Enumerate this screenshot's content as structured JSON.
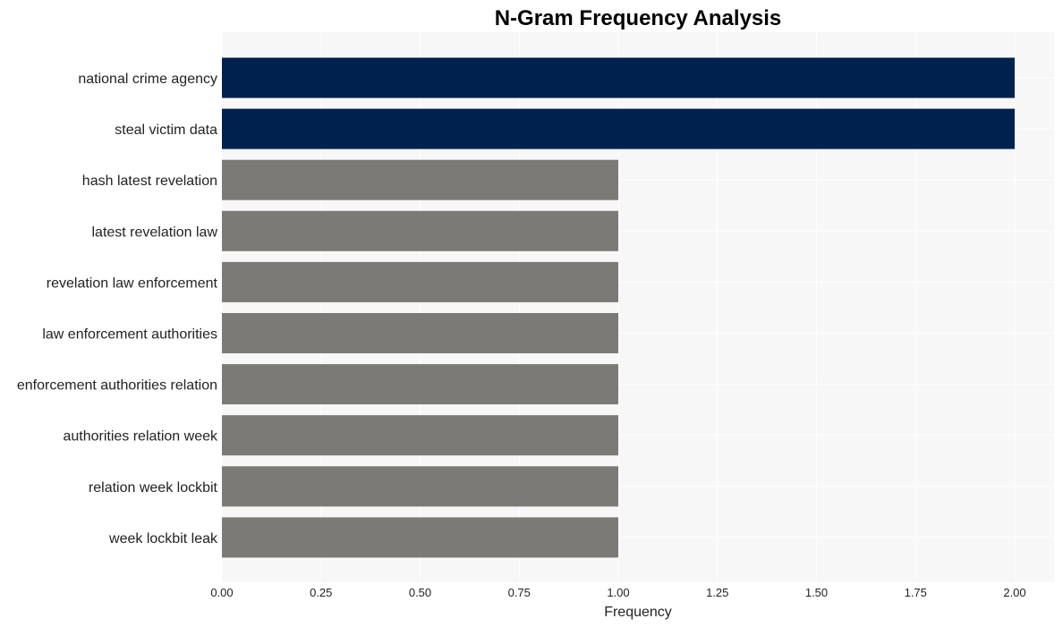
{
  "chart_data": {
    "type": "bar",
    "orientation": "horizontal",
    "title": "N-Gram Frequency Analysis",
    "xlabel": "Frequency",
    "ylabel": "",
    "categories": [
      "national crime agency",
      "steal victim data",
      "hash latest revelation",
      "latest revelation law",
      "revelation law enforcement",
      "law enforcement authorities",
      "enforcement authorities relation",
      "authorities relation week",
      "relation week lockbit",
      "week lockbit leak"
    ],
    "values": [
      2,
      2,
      1,
      1,
      1,
      1,
      1,
      1,
      1,
      1
    ],
    "bar_colors": [
      "#00204e",
      "#00204e",
      "#7b7a76",
      "#7b7a76",
      "#7b7a76",
      "#7b7a76",
      "#7b7a76",
      "#7b7a76",
      "#7b7a76",
      "#7b7a76"
    ],
    "xlim": [
      0,
      2.1
    ],
    "xticks": [
      0,
      0.25,
      0.5,
      0.75,
      1.0,
      1.25,
      1.5,
      1.75,
      2.0
    ],
    "xtick_labels": [
      "0.00",
      "0.25",
      "0.50",
      "0.75",
      "1.00",
      "1.25",
      "1.50",
      "1.75",
      "2.00"
    ],
    "grid": true,
    "legend": "none",
    "background_color": "#f7f7f7",
    "grid_color": "#ffffff"
  }
}
